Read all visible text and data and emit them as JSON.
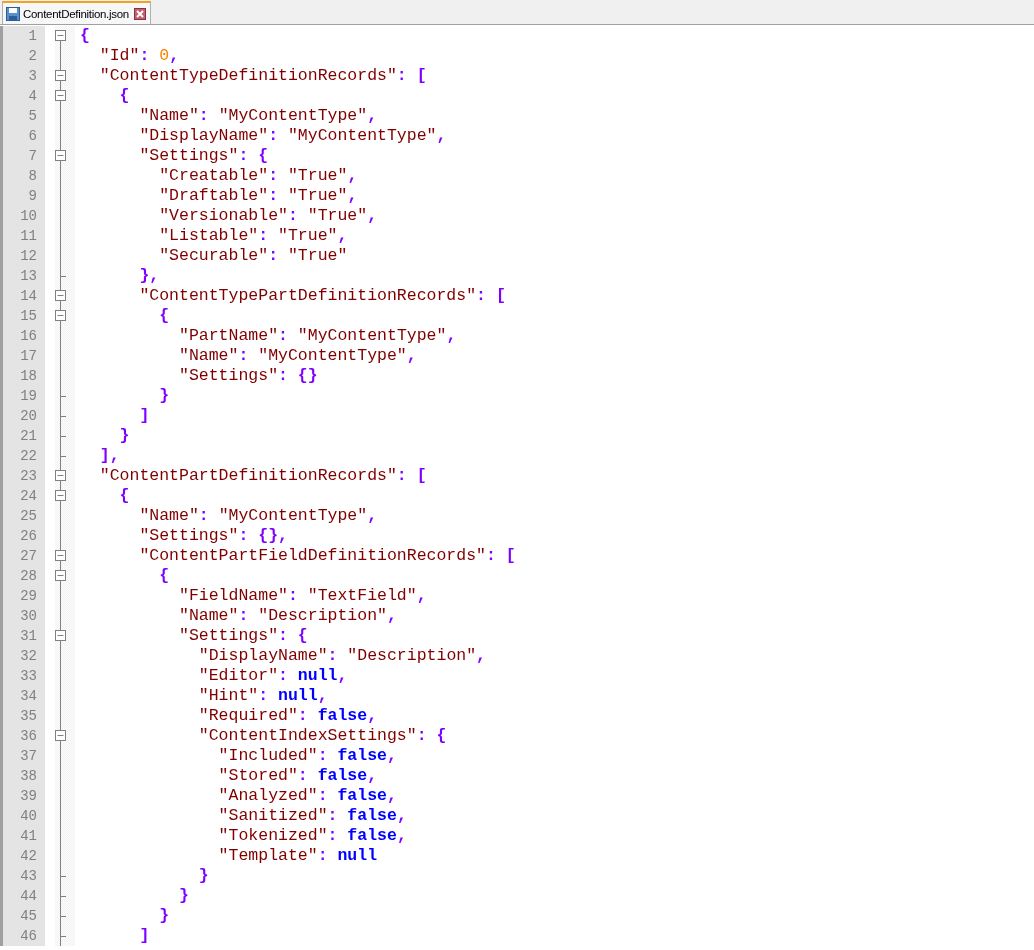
{
  "tab": {
    "title": "ContentDefinition.json",
    "selected": true
  },
  "lines": [
    {
      "number": "1",
      "fold_start": true,
      "fold_end": false,
      "tokens": [
        {
          "kind": "p",
          "text": "{"
        }
      ]
    },
    {
      "number": "2",
      "fold_start": false,
      "fold_end": false,
      "tokens": [
        {
          "kind": "k",
          "text": "  \"Id\""
        },
        {
          "kind": "p",
          "text": ": "
        },
        {
          "kind": "n",
          "text": "0"
        },
        {
          "kind": "p",
          "text": ","
        }
      ]
    },
    {
      "number": "3",
      "fold_start": true,
      "fold_end": false,
      "tokens": [
        {
          "kind": "k",
          "text": "  \"ContentTypeDefinitionRecords\""
        },
        {
          "kind": "p",
          "text": ": ["
        }
      ]
    },
    {
      "number": "4",
      "fold_start": true,
      "fold_end": false,
      "tokens": [
        {
          "kind": "p",
          "text": "    {"
        }
      ]
    },
    {
      "number": "5",
      "fold_start": false,
      "fold_end": false,
      "tokens": [
        {
          "kind": "k",
          "text": "      \"Name\""
        },
        {
          "kind": "p",
          "text": ": "
        },
        {
          "kind": "s",
          "text": "\"MyContentType\""
        },
        {
          "kind": "p",
          "text": ","
        }
      ]
    },
    {
      "number": "6",
      "fold_start": false,
      "fold_end": false,
      "tokens": [
        {
          "kind": "k",
          "text": "      \"DisplayName\""
        },
        {
          "kind": "p",
          "text": ": "
        },
        {
          "kind": "s",
          "text": "\"MyContentType\""
        },
        {
          "kind": "p",
          "text": ","
        }
      ]
    },
    {
      "number": "7",
      "fold_start": true,
      "fold_end": false,
      "tokens": [
        {
          "kind": "k",
          "text": "      \"Settings\""
        },
        {
          "kind": "p",
          "text": ": {"
        }
      ]
    },
    {
      "number": "8",
      "fold_start": false,
      "fold_end": false,
      "tokens": [
        {
          "kind": "k",
          "text": "        \"Creatable\""
        },
        {
          "kind": "p",
          "text": ": "
        },
        {
          "kind": "s",
          "text": "\"True\""
        },
        {
          "kind": "p",
          "text": ","
        }
      ]
    },
    {
      "number": "9",
      "fold_start": false,
      "fold_end": false,
      "tokens": [
        {
          "kind": "k",
          "text": "        \"Draftable\""
        },
        {
          "kind": "p",
          "text": ": "
        },
        {
          "kind": "s",
          "text": "\"True\""
        },
        {
          "kind": "p",
          "text": ","
        }
      ]
    },
    {
      "number": "10",
      "fold_start": false,
      "fold_end": false,
      "tokens": [
        {
          "kind": "k",
          "text": "        \"Versionable\""
        },
        {
          "kind": "p",
          "text": ": "
        },
        {
          "kind": "s",
          "text": "\"True\""
        },
        {
          "kind": "p",
          "text": ","
        }
      ]
    },
    {
      "number": "11",
      "fold_start": false,
      "fold_end": false,
      "tokens": [
        {
          "kind": "k",
          "text": "        \"Listable\""
        },
        {
          "kind": "p",
          "text": ": "
        },
        {
          "kind": "s",
          "text": "\"True\""
        },
        {
          "kind": "p",
          "text": ","
        }
      ]
    },
    {
      "number": "12",
      "fold_start": false,
      "fold_end": false,
      "tokens": [
        {
          "kind": "k",
          "text": "        \"Securable\""
        },
        {
          "kind": "p",
          "text": ": "
        },
        {
          "kind": "s",
          "text": "\"True\""
        }
      ]
    },
    {
      "number": "13",
      "fold_start": false,
      "fold_end": true,
      "tokens": [
        {
          "kind": "p",
          "text": "      },"
        }
      ]
    },
    {
      "number": "14",
      "fold_start": true,
      "fold_end": false,
      "tokens": [
        {
          "kind": "k",
          "text": "      \"ContentTypePartDefinitionRecords\""
        },
        {
          "kind": "p",
          "text": ": ["
        }
      ]
    },
    {
      "number": "15",
      "fold_start": true,
      "fold_end": false,
      "tokens": [
        {
          "kind": "p",
          "text": "        {"
        }
      ]
    },
    {
      "number": "16",
      "fold_start": false,
      "fold_end": false,
      "tokens": [
        {
          "kind": "k",
          "text": "          \"PartName\""
        },
        {
          "kind": "p",
          "text": ": "
        },
        {
          "kind": "s",
          "text": "\"MyContentType\""
        },
        {
          "kind": "p",
          "text": ","
        }
      ]
    },
    {
      "number": "17",
      "fold_start": false,
      "fold_end": false,
      "tokens": [
        {
          "kind": "k",
          "text": "          \"Name\""
        },
        {
          "kind": "p",
          "text": ": "
        },
        {
          "kind": "s",
          "text": "\"MyContentType\""
        },
        {
          "kind": "p",
          "text": ","
        }
      ]
    },
    {
      "number": "18",
      "fold_start": false,
      "fold_end": false,
      "tokens": [
        {
          "kind": "k",
          "text": "          \"Settings\""
        },
        {
          "kind": "p",
          "text": ": {}"
        }
      ]
    },
    {
      "number": "19",
      "fold_start": false,
      "fold_end": true,
      "tokens": [
        {
          "kind": "p",
          "text": "        }"
        }
      ]
    },
    {
      "number": "20",
      "fold_start": false,
      "fold_end": true,
      "tokens": [
        {
          "kind": "p",
          "text": "      ]"
        }
      ]
    },
    {
      "number": "21",
      "fold_start": false,
      "fold_end": true,
      "tokens": [
        {
          "kind": "p",
          "text": "    }"
        }
      ]
    },
    {
      "number": "22",
      "fold_start": false,
      "fold_end": true,
      "tokens": [
        {
          "kind": "p",
          "text": "  ],"
        }
      ]
    },
    {
      "number": "23",
      "fold_start": true,
      "fold_end": false,
      "tokens": [
        {
          "kind": "k",
          "text": "  \"ContentPartDefinitionRecords\""
        },
        {
          "kind": "p",
          "text": ": ["
        }
      ]
    },
    {
      "number": "24",
      "fold_start": true,
      "fold_end": false,
      "tokens": [
        {
          "kind": "p",
          "text": "    {"
        }
      ]
    },
    {
      "number": "25",
      "fold_start": false,
      "fold_end": false,
      "tokens": [
        {
          "kind": "k",
          "text": "      \"Name\""
        },
        {
          "kind": "p",
          "text": ": "
        },
        {
          "kind": "s",
          "text": "\"MyContentType\""
        },
        {
          "kind": "p",
          "text": ","
        }
      ]
    },
    {
      "number": "26",
      "fold_start": false,
      "fold_end": false,
      "tokens": [
        {
          "kind": "k",
          "text": "      \"Settings\""
        },
        {
          "kind": "p",
          "text": ": {},"
        }
      ]
    },
    {
      "number": "27",
      "fold_start": true,
      "fold_end": false,
      "tokens": [
        {
          "kind": "k",
          "text": "      \"ContentPartFieldDefinitionRecords\""
        },
        {
          "kind": "p",
          "text": ": ["
        }
      ]
    },
    {
      "number": "28",
      "fold_start": true,
      "fold_end": false,
      "tokens": [
        {
          "kind": "p",
          "text": "        {"
        }
      ]
    },
    {
      "number": "29",
      "fold_start": false,
      "fold_end": false,
      "tokens": [
        {
          "kind": "k",
          "text": "          \"FieldName\""
        },
        {
          "kind": "p",
          "text": ": "
        },
        {
          "kind": "s",
          "text": "\"TextField\""
        },
        {
          "kind": "p",
          "text": ","
        }
      ]
    },
    {
      "number": "30",
      "fold_start": false,
      "fold_end": false,
      "tokens": [
        {
          "kind": "k",
          "text": "          \"Name\""
        },
        {
          "kind": "p",
          "text": ": "
        },
        {
          "kind": "s",
          "text": "\"Description\""
        },
        {
          "kind": "p",
          "text": ","
        }
      ]
    },
    {
      "number": "31",
      "fold_start": true,
      "fold_end": false,
      "tokens": [
        {
          "kind": "k",
          "text": "          \"Settings\""
        },
        {
          "kind": "p",
          "text": ": {"
        }
      ]
    },
    {
      "number": "32",
      "fold_start": false,
      "fold_end": false,
      "tokens": [
        {
          "kind": "k",
          "text": "            \"DisplayName\""
        },
        {
          "kind": "p",
          "text": ": "
        },
        {
          "kind": "s",
          "text": "\"Description\""
        },
        {
          "kind": "p",
          "text": ","
        }
      ]
    },
    {
      "number": "33",
      "fold_start": false,
      "fold_end": false,
      "tokens": [
        {
          "kind": "k",
          "text": "            \"Editor\""
        },
        {
          "kind": "p",
          "text": ": "
        },
        {
          "kind": "w",
          "text": "null"
        },
        {
          "kind": "p",
          "text": ","
        }
      ]
    },
    {
      "number": "34",
      "fold_start": false,
      "fold_end": false,
      "tokens": [
        {
          "kind": "k",
          "text": "            \"Hint\""
        },
        {
          "kind": "p",
          "text": ": "
        },
        {
          "kind": "w",
          "text": "null"
        },
        {
          "kind": "p",
          "text": ","
        }
      ]
    },
    {
      "number": "35",
      "fold_start": false,
      "fold_end": false,
      "tokens": [
        {
          "kind": "k",
          "text": "            \"Required\""
        },
        {
          "kind": "p",
          "text": ": "
        },
        {
          "kind": "w",
          "text": "false"
        },
        {
          "kind": "p",
          "text": ","
        }
      ]
    },
    {
      "number": "36",
      "fold_start": true,
      "fold_end": false,
      "tokens": [
        {
          "kind": "k",
          "text": "            \"ContentIndexSettings\""
        },
        {
          "kind": "p",
          "text": ": {"
        }
      ]
    },
    {
      "number": "37",
      "fold_start": false,
      "fold_end": false,
      "tokens": [
        {
          "kind": "k",
          "text": "              \"Included\""
        },
        {
          "kind": "p",
          "text": ": "
        },
        {
          "kind": "w",
          "text": "false"
        },
        {
          "kind": "p",
          "text": ","
        }
      ]
    },
    {
      "number": "38",
      "fold_start": false,
      "fold_end": false,
      "tokens": [
        {
          "kind": "k",
          "text": "              \"Stored\""
        },
        {
          "kind": "p",
          "text": ": "
        },
        {
          "kind": "w",
          "text": "false"
        },
        {
          "kind": "p",
          "text": ","
        }
      ]
    },
    {
      "number": "39",
      "fold_start": false,
      "fold_end": false,
      "tokens": [
        {
          "kind": "k",
          "text": "              \"Analyzed\""
        },
        {
          "kind": "p",
          "text": ": "
        },
        {
          "kind": "w",
          "text": "false"
        },
        {
          "kind": "p",
          "text": ","
        }
      ]
    },
    {
      "number": "40",
      "fold_start": false,
      "fold_end": false,
      "tokens": [
        {
          "kind": "k",
          "text": "              \"Sanitized\""
        },
        {
          "kind": "p",
          "text": ": "
        },
        {
          "kind": "w",
          "text": "false"
        },
        {
          "kind": "p",
          "text": ","
        }
      ]
    },
    {
      "number": "41",
      "fold_start": false,
      "fold_end": false,
      "tokens": [
        {
          "kind": "k",
          "text": "              \"Tokenized\""
        },
        {
          "kind": "p",
          "text": ": "
        },
        {
          "kind": "w",
          "text": "false"
        },
        {
          "kind": "p",
          "text": ","
        }
      ]
    },
    {
      "number": "42",
      "fold_start": false,
      "fold_end": false,
      "tokens": [
        {
          "kind": "k",
          "text": "              \"Template\""
        },
        {
          "kind": "p",
          "text": ": "
        },
        {
          "kind": "w",
          "text": "null"
        }
      ]
    },
    {
      "number": "43",
      "fold_start": false,
      "fold_end": true,
      "tokens": [
        {
          "kind": "p",
          "text": "            }"
        }
      ]
    },
    {
      "number": "44",
      "fold_start": false,
      "fold_end": true,
      "tokens": [
        {
          "kind": "p",
          "text": "          }"
        }
      ]
    },
    {
      "number": "45",
      "fold_start": false,
      "fold_end": true,
      "tokens": [
        {
          "kind": "p",
          "text": "        }"
        }
      ]
    },
    {
      "number": "46",
      "fold_start": false,
      "fold_end": true,
      "tokens": [
        {
          "kind": "p",
          "text": "      ]"
        }
      ]
    }
  ]
}
